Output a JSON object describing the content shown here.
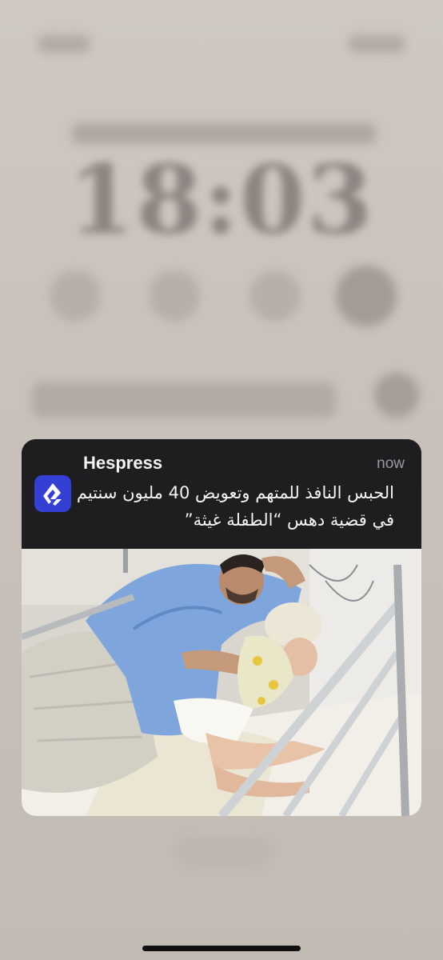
{
  "notification": {
    "app_name": "Hespress",
    "time": "now",
    "message": "الحبس النافذ للمتهم وتعويض 40 مليون سنتيم في قضية دهس “الطفلة غيثة”",
    "app_icon": "hespress-logo-icon",
    "accent_color": "#3340d3"
  },
  "lock_screen": {
    "clock": "18:03"
  }
}
